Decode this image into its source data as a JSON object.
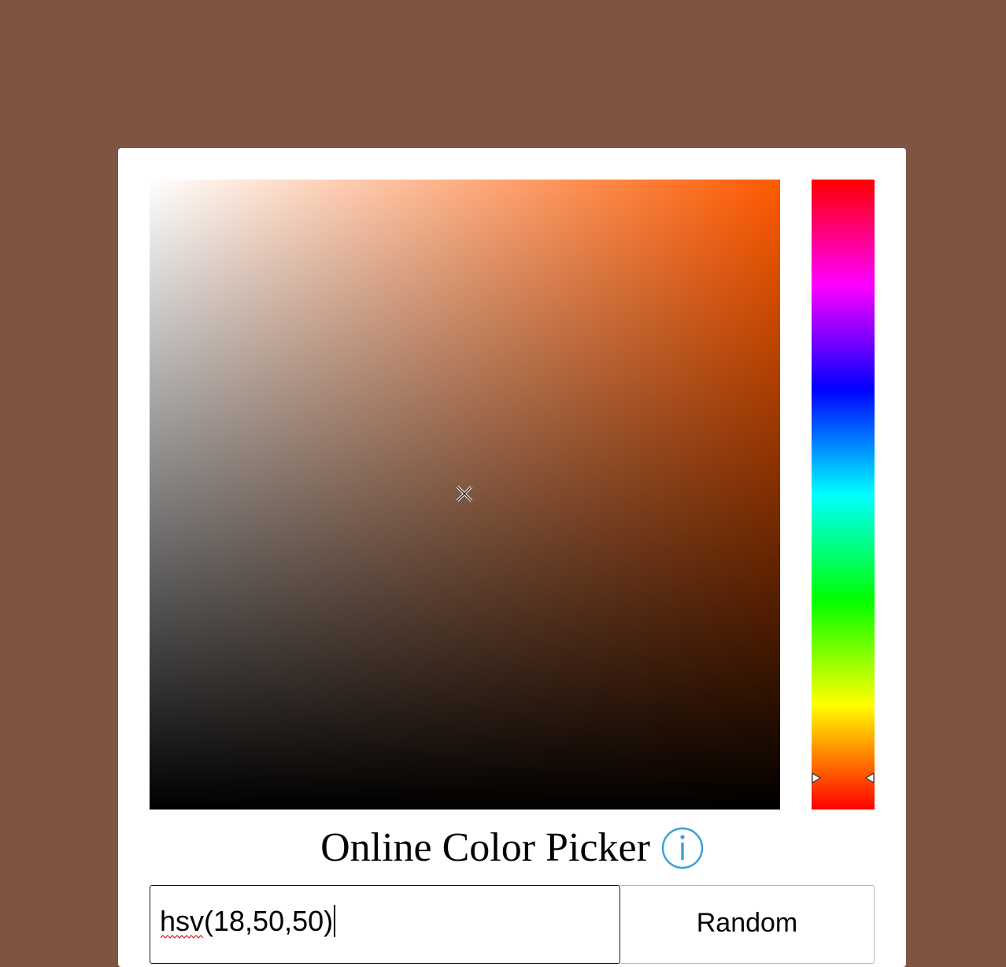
{
  "app": {
    "title": "Online Color Picker",
    "background_color": "#805442"
  },
  "picker": {
    "hue_color": "#ff5a00",
    "hue_value": 18,
    "saturation_value": 50,
    "value_value": 50,
    "marker_icon": "crosshair-x-icon",
    "hue_indicator_icon": "triangle-arrow-icon"
  },
  "footer": {
    "title": "Online Color Picker",
    "info_icon": "info-circle-icon",
    "info_icon_color": "#3aa0d8"
  },
  "input": {
    "value": "hsv(18,50,50)"
  },
  "buttons": {
    "random_label": "Random"
  }
}
